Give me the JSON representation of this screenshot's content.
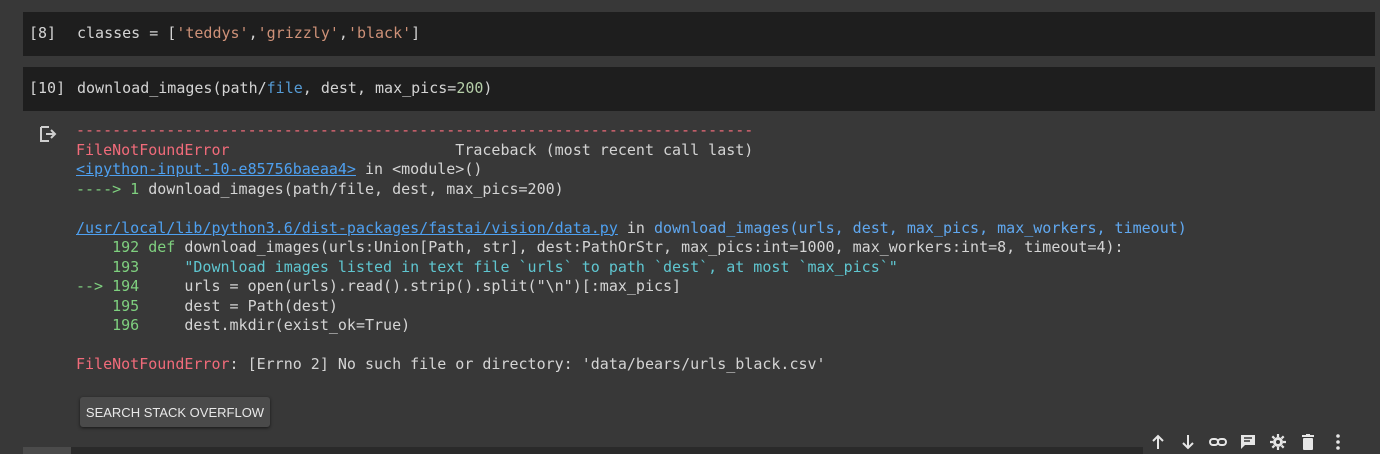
{
  "cells": [
    {
      "prompt": "[8]",
      "code": {
        "prefix": "classes = [",
        "s1": "'teddys'",
        "c1": ",",
        "s2": "'grizzly'",
        "c2": ",",
        "s3": "'black'",
        "suffix": "]"
      }
    },
    {
      "prompt": "[10]",
      "code": {
        "p1": "download_images(path/",
        "kw_file": "file",
        "p2": ", dest, max_pics=",
        "num": "200",
        "p3": ")"
      }
    }
  ],
  "output": {
    "dashes": "---------------------------------------------------------------------------",
    "error_name": "FileNotFoundError",
    "traceback_header": "                         Traceback (most recent call last)",
    "input_link": "<ipython-input-10-e85756baeaa4>",
    "in_module": " in <module>()",
    "arrow1": "----> 1 ",
    "arrow1_code": "download_images(path/file, dest, max_pics=200)",
    "file_link": "/usr/local/lib/python3.6/dist-packages/fastai/vision/data.py",
    "file_in": " in ",
    "file_func": "download_images(urls, dest, max_pics, max_workers, timeout)",
    "l192_no": "    192 ",
    "l192_def": "def",
    "l192_code": " download_images(urls:Union[Path, str], dest:PathOrStr, max_pics:int=1000, max_workers:int=8, timeout=4):",
    "l193_no": "    193 ",
    "l193_code": "    \"Download images listed in text file `urls` to path `dest`, at most `max_pics`\"",
    "l194_arrow": "--> 194 ",
    "l194_code": "    urls = open(urls).read().strip().split(\"\\n\")[:max_pics]",
    "l195_no": "    195 ",
    "l195_code": "    dest = Path(dest)",
    "l196_no": "    196 ",
    "l196_code": "    dest.mkdir(exist_ok=True)",
    "final_error_name": "FileNotFoundError",
    "final_error_msg": ": [Errno 2] No such file or directory: 'data/bears/urls_black.csv'"
  },
  "button": {
    "label": "SEARCH STACK OVERFLOW"
  },
  "toolbar": {
    "icons": [
      "arrow-up-icon",
      "arrow-down-icon",
      "link-icon",
      "comment-icon",
      "gear-icon",
      "trash-icon",
      "more-vert-icon"
    ]
  }
}
